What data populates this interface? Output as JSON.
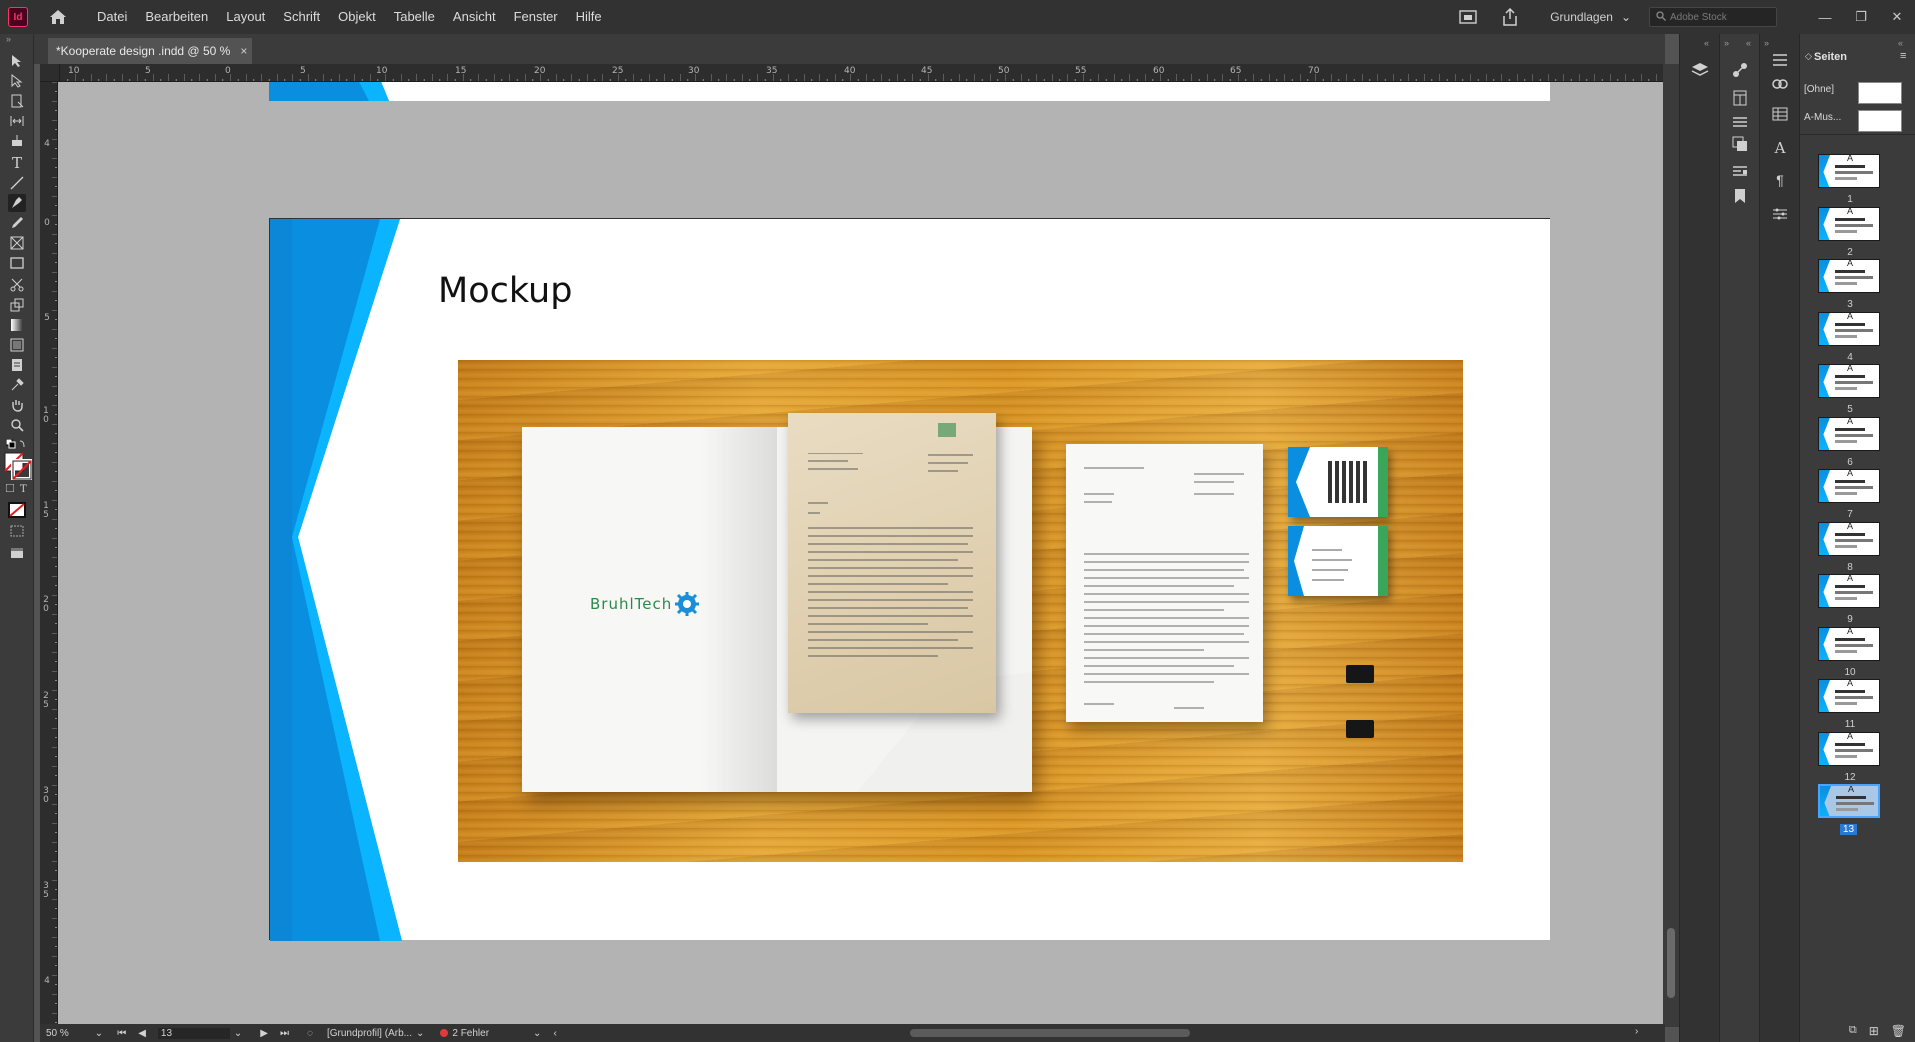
{
  "app": {
    "logo_text": "Id"
  },
  "menu": [
    "Datei",
    "Bearbeiten",
    "Layout",
    "Schrift",
    "Objekt",
    "Tabelle",
    "Ansicht",
    "Fenster",
    "Hilfe"
  ],
  "menubar_right": {
    "workspace": "Grundlagen",
    "search_placeholder": "Adobe Stock"
  },
  "document_tab": {
    "title": "*Kooperate design .indd @ 50 %",
    "close": "×"
  },
  "ruler": {
    "top_labels": [
      "10",
      "5",
      "0",
      "5",
      "10",
      "15",
      "20",
      "25",
      "30",
      "35",
      "40",
      "45",
      "50",
      "55",
      "60",
      "65",
      "70"
    ],
    "left_labels": [
      "4",
      "0",
      "5",
      "1 0",
      "1 5",
      "2 0",
      "2 5",
      "3 0",
      "3 5",
      "4"
    ]
  },
  "slide": {
    "title": "Mockup",
    "brand": "BruhlTech"
  },
  "pages_panel": {
    "title": "Seiten",
    "masters": [
      {
        "label": "[Ohne]"
      },
      {
        "label": "A-Mus..."
      }
    ],
    "pages": [
      "1",
      "2",
      "3",
      "4",
      "5",
      "6",
      "7",
      "8",
      "9",
      "10",
      "11",
      "12",
      "13"
    ],
    "selected_page": "13"
  },
  "statusbar": {
    "zoom": "50 %",
    "page": "13",
    "profile": "[Grundprofil] (Arb...",
    "errors": "2 Fehler"
  },
  "colors": {
    "accent_blue": "#0a8fe0",
    "accent_cyan": "#0ab4ff",
    "error_red": "#e03b3b",
    "selection_blue": "#2a78d4"
  }
}
